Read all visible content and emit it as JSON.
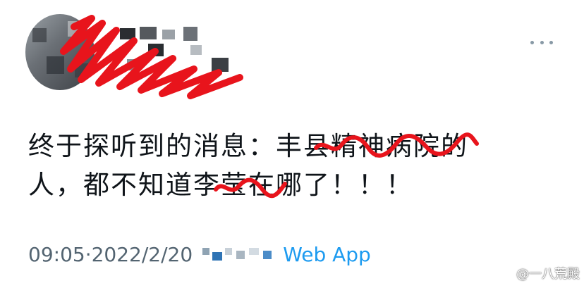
{
  "tweet": {
    "text_line1": "终于探听到的消息：丰县精神病院的",
    "text_line2": "人，都不知道李莹在哪了！！！",
    "time": "09:05",
    "separator": " · ",
    "date": "2022/2/20",
    "source_app": "Web App"
  },
  "watermark": {
    "text": "@一八荒殿"
  },
  "colors": {
    "text": "#0f1419",
    "meta": "#536471",
    "link": "#1d9bf0",
    "scribble": "#e8141c"
  },
  "icons": {
    "more": "more-horizontal-icon",
    "watermark": "weibo-icon"
  }
}
